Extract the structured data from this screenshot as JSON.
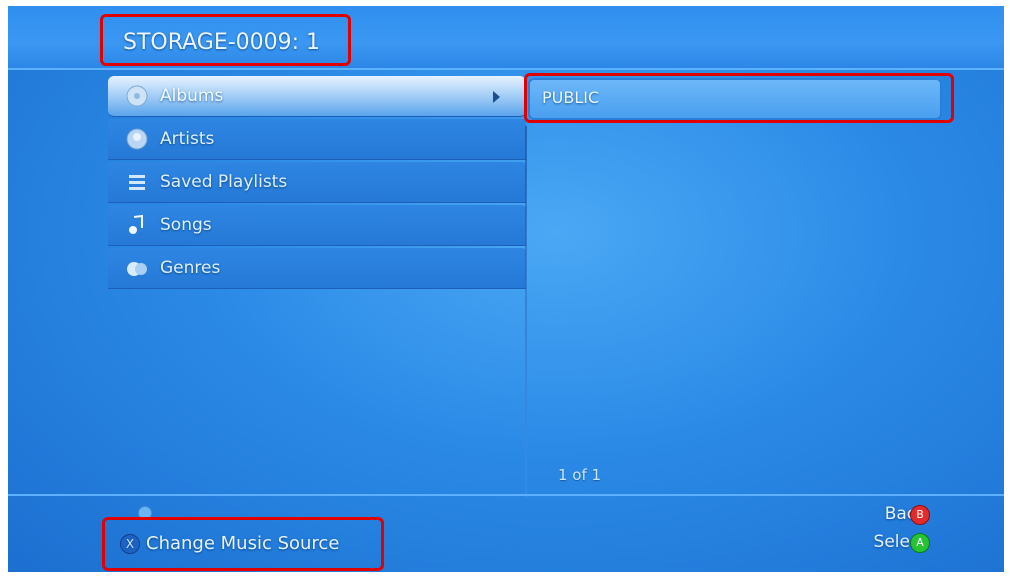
{
  "header": {
    "title": "STORAGE-0009: 1"
  },
  "menu": {
    "items": [
      {
        "label": "Albums",
        "icon": "album-icon",
        "selected": true
      },
      {
        "label": "Artists",
        "icon": "artist-icon",
        "selected": false
      },
      {
        "label": "Saved Playlists",
        "icon": "playlist-icon",
        "selected": false
      },
      {
        "label": "Songs",
        "icon": "song-icon",
        "selected": false
      },
      {
        "label": "Genres",
        "icon": "genre-icon",
        "selected": false
      }
    ]
  },
  "right_panel": {
    "items": [
      {
        "label": "PUBLIC"
      }
    ]
  },
  "pagination": {
    "text": "1 of 1"
  },
  "footer": {
    "change_source": "Change Music Source",
    "change_source_button": "X",
    "back": "Back",
    "back_button": "B",
    "select": "Select",
    "select_button": "A"
  },
  "colors": {
    "background": "#2b8ae6",
    "highlight_box": "#e00000",
    "button_b": "#e32b2b",
    "button_a": "#27c235"
  }
}
